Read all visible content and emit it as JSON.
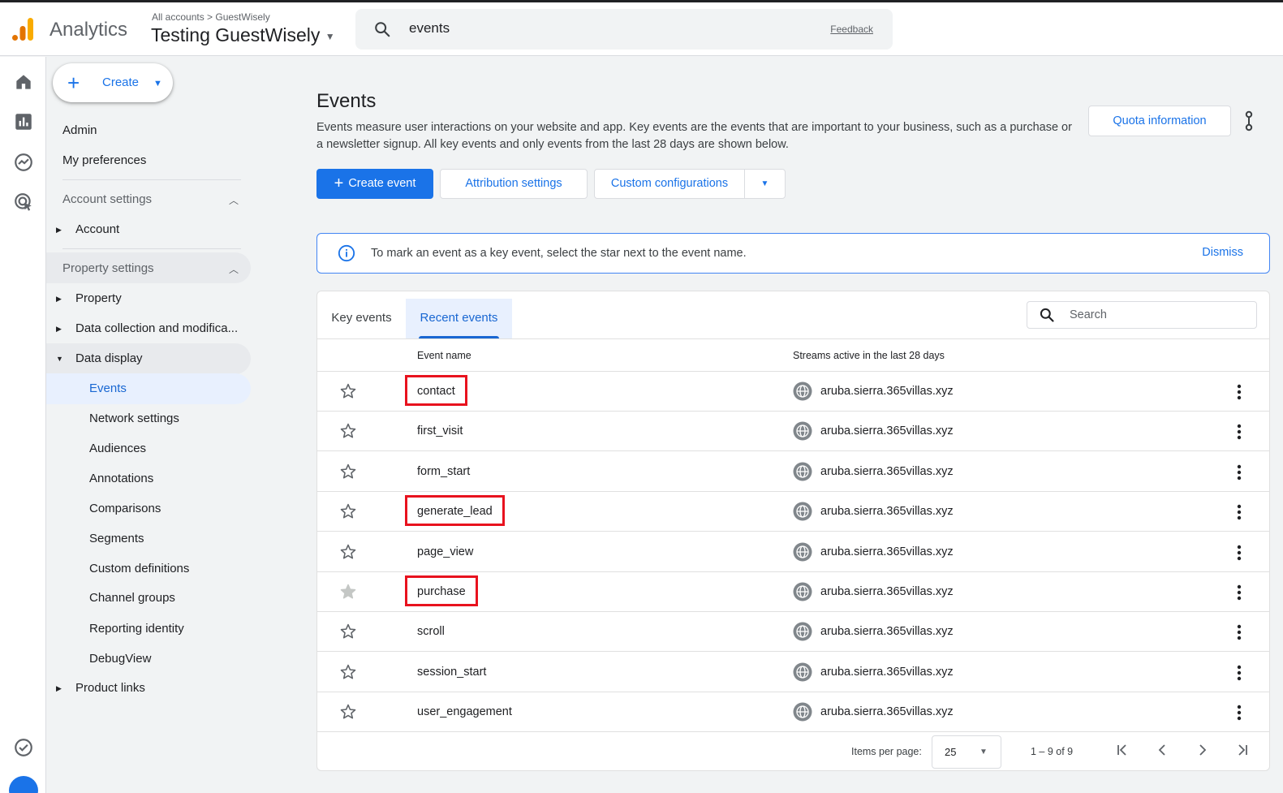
{
  "header": {
    "app_name": "Analytics",
    "breadcrumb": "All accounts > GuestWisely",
    "property_name": "Testing GuestWisely",
    "search_value": "events",
    "feedback_label": "Feedback"
  },
  "rail": {
    "icons": [
      "home-icon",
      "reports-icon",
      "explore-icon",
      "advertising-icon",
      "insights-icon",
      "admin-gear-icon"
    ]
  },
  "nav": {
    "create_label": "Create",
    "admin": "Admin",
    "my_preferences": "My preferences",
    "account_settings": "Account settings",
    "account": "Account",
    "property_settings": "Property settings",
    "property": "Property",
    "data_collection": "Data collection and modifica...",
    "data_display": "Data display",
    "sub_items": [
      "Events",
      "Network settings",
      "Audiences",
      "Annotations",
      "Comparisons",
      "Segments",
      "Custom definitions",
      "Channel groups",
      "Reporting identity",
      "DebugView"
    ],
    "product_links": "Product links"
  },
  "main": {
    "title": "Events",
    "description": "Events measure user interactions on your website and app. Key events are the events that are important to your business, such as a purchase or a newsletter signup. All key events and only events from the last 28 days are shown below.",
    "quota_button": "Quota information",
    "create_event": "Create event",
    "attribution_settings": "Attribution settings",
    "custom_configurations": "Custom configurations",
    "info_text": "To mark an event as a key event, select the star next to the event name.",
    "dismiss": "Dismiss"
  },
  "table": {
    "tabs": [
      "Key events",
      "Recent events"
    ],
    "active_tab": "Recent events",
    "search_placeholder": "Search",
    "headers": {
      "event_name": "Event name",
      "streams": "Streams active in the last 28 days"
    },
    "rows": [
      {
        "name": "contact",
        "stream": "aruba.sierra.365villas.xyz",
        "highlighted": true,
        "key_event": false
      },
      {
        "name": "first_visit",
        "stream": "aruba.sierra.365villas.xyz",
        "highlighted": false,
        "key_event": false
      },
      {
        "name": "form_start",
        "stream": "aruba.sierra.365villas.xyz",
        "highlighted": false,
        "key_event": false
      },
      {
        "name": "generate_lead",
        "stream": "aruba.sierra.365villas.xyz",
        "highlighted": true,
        "key_event": false
      },
      {
        "name": "page_view",
        "stream": "aruba.sierra.365villas.xyz",
        "highlighted": false,
        "key_event": false
      },
      {
        "name": "purchase",
        "stream": "aruba.sierra.365villas.xyz",
        "highlighted": true,
        "key_event": true
      },
      {
        "name": "scroll",
        "stream": "aruba.sierra.365villas.xyz",
        "highlighted": false,
        "key_event": false
      },
      {
        "name": "session_start",
        "stream": "aruba.sierra.365villas.xyz",
        "highlighted": false,
        "key_event": false
      },
      {
        "name": "user_engagement",
        "stream": "aruba.sierra.365villas.xyz",
        "highlighted": false,
        "key_event": false
      }
    ],
    "items_per_page_label": "Items per page:",
    "items_per_page": "25",
    "range": "1 – 9 of 9"
  },
  "colors": {
    "accent": "#1a73e8",
    "highlight_box": "#e8121e",
    "logo_orange": "#f9ab00",
    "logo_dark_orange": "#e37400"
  }
}
